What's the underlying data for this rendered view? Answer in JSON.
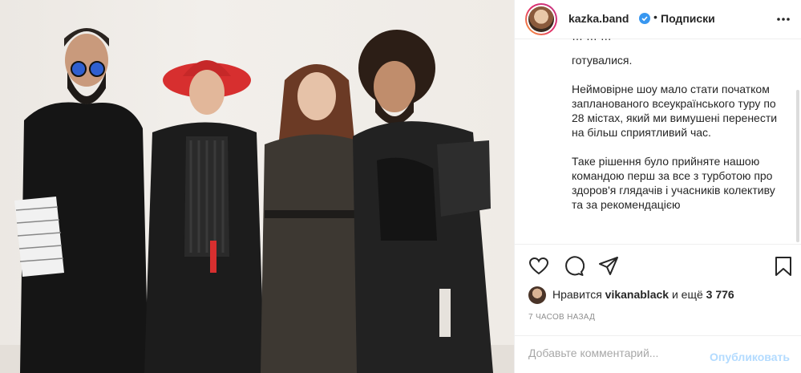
{
  "post": {
    "photo_alt": "",
    "colors": {
      "verified": "#3897f0",
      "publish_disabled": "#b3dbff",
      "muted": "#8e8e8e"
    }
  },
  "header": {
    "username": "kazka.band",
    "verified_icon": "verified-badge-icon",
    "separator": "•",
    "follow_label": "Подписки",
    "more_icon": "more-horizontal-icon"
  },
  "caption": {
    "cut_line": "… … …",
    "paragraphs": [
      "готувалися.",
      "Неймовірне шоу мало стати початком запланованого всеукраїнського туру по 28 містах, який ми вимушені перенести на більш сприятливий час.",
      "Таке рішення було прийняте нашою командою перш за все з турботою про здоров'я глядачів і учасників колективу та за рекомендацією"
    ]
  },
  "actions": {
    "like_icon": "heart-icon",
    "comment_icon": "comment-icon",
    "share_icon": "share-icon",
    "save_icon": "bookmark-icon"
  },
  "likes": {
    "prefix": "Нравится",
    "user": "vikanablack",
    "middle": "и ещё",
    "count": "3 776"
  },
  "time_ago": "7 часов назад",
  "comment": {
    "placeholder": "Добавьте комментарий...",
    "publish_label": "Опубликовать"
  }
}
